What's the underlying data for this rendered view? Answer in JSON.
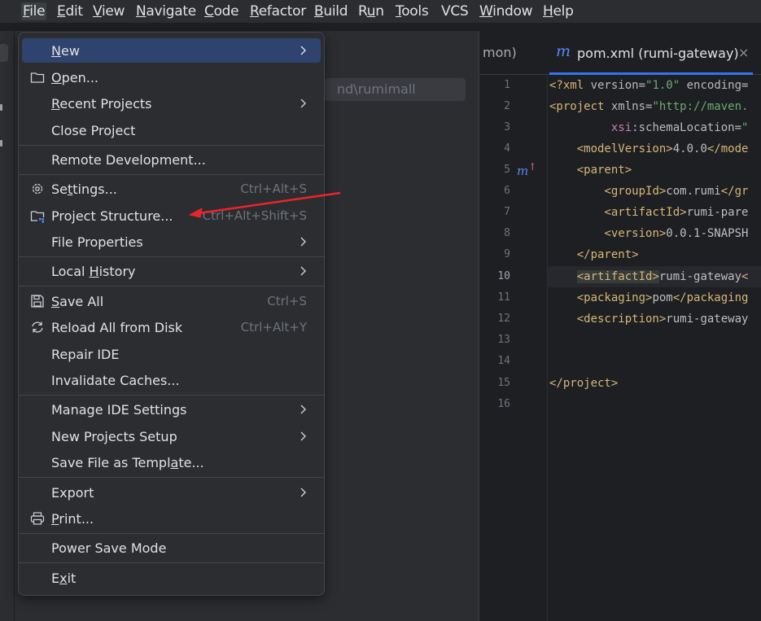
{
  "menubar": {
    "items": [
      {
        "label": "File",
        "u": "F",
        "rest": "ile"
      },
      {
        "label": "Edit",
        "u": "E",
        "rest": "dit"
      },
      {
        "label": "View",
        "u": "V",
        "rest": "iew"
      },
      {
        "label": "Navigate",
        "u": "N",
        "rest": "avigate"
      },
      {
        "label": "Code",
        "u": "C",
        "rest": "ode"
      },
      {
        "label": "Refactor",
        "u": "R",
        "rest": "efactor"
      },
      {
        "label": "Build",
        "u": "B",
        "rest": "uild"
      },
      {
        "label": "Run",
        "u": "",
        "rest": "Run",
        "pre": "R",
        "post": "n",
        "mid": "u"
      },
      {
        "label": "Tools",
        "u": "T",
        "rest": "ools"
      },
      {
        "label": "VCS",
        "u": "",
        "rest": "VCS"
      },
      {
        "label": "Window",
        "u": "W",
        "rest": "indow"
      },
      {
        "label": "Help",
        "u": "H",
        "rest": "elp"
      }
    ]
  },
  "project_panel": {
    "path_field_value": "nd\\rumimall"
  },
  "editor": {
    "prev_tab_label": "mon)",
    "active_tab_icon": "m",
    "active_tab_label": "pom.xml (rumi-gateway)",
    "close_glyph": "×",
    "line_numbers": [
      "1",
      "2",
      "3",
      "4",
      "5",
      "6",
      "7",
      "8",
      "9",
      "10",
      "11",
      "12",
      "13",
      "14",
      "15",
      "16"
    ],
    "current_line": "10",
    "gutter_marker": "m"
  },
  "file_menu": {
    "new": {
      "u": "N",
      "rest": "ew"
    },
    "open": {
      "u": "O",
      "rest": "pen..."
    },
    "recent_projects": {
      "u": "R",
      "rest": "ecent Projects"
    },
    "close_project": "Close Project",
    "remote_development": "Remote Development...",
    "settings": {
      "pre": "Se",
      "u": "t",
      "rest": "tings..."
    },
    "settings_shortcut": "Ctrl+Alt+S",
    "project_structure": "Project Structure...",
    "project_structure_shortcut": "Ctrl+Alt+Shift+S",
    "file_properties": "File Properties",
    "local_history": {
      "pre": "Local ",
      "u": "H",
      "rest": "istory"
    },
    "save_all": {
      "u": "S",
      "rest": "ave All"
    },
    "save_all_shortcut": "Ctrl+S",
    "reload_all": "Reload All from Disk",
    "reload_all_shortcut": "Ctrl+Alt+Y",
    "repair_ide": "Repair IDE",
    "invalidate_caches": "Invalidate Caches...",
    "manage_ide_settings": "Manage IDE Settings",
    "new_projects_setup": "New Projects Setup",
    "save_as_template": {
      "pre": "Save File as Templ",
      "u": "a",
      "rest": "te..."
    },
    "export": "Export",
    "print": {
      "u": "P",
      "rest": "rint..."
    },
    "power_save_mode": "Power Save Mode",
    "exit": {
      "pre": "E",
      "u": "x",
      "rest": "it"
    }
  },
  "colors": {
    "accent": "#3574f0",
    "selected_item": "#2e436e",
    "annotation_arrow": "#e8262a"
  }
}
